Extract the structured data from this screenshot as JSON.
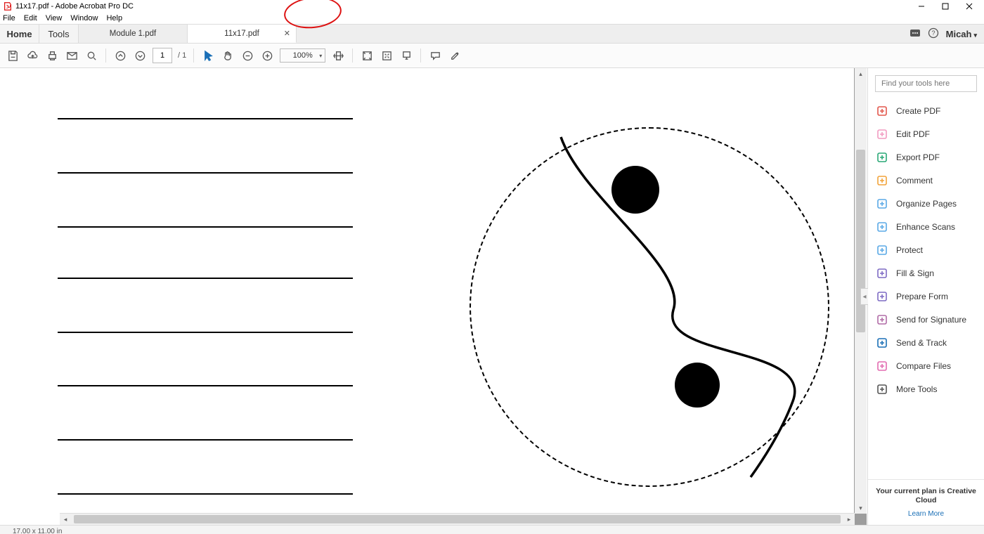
{
  "window": {
    "title": "11x17.pdf - Adobe Acrobat Pro DC"
  },
  "menu": {
    "file": "File",
    "edit": "Edit",
    "view": "View",
    "window": "Window",
    "help": "Help"
  },
  "tabs": {
    "home": "Home",
    "tools": "Tools",
    "docs": [
      {
        "label": "Module 1.pdf",
        "active": false
      },
      {
        "label": "11x17.pdf",
        "active": true
      }
    ],
    "user": "Micah"
  },
  "toolbar": {
    "page_current": "1",
    "page_total": "/ 1",
    "zoom": "100%"
  },
  "right_panel": {
    "search_placeholder": "Find your tools here",
    "items": [
      {
        "label": "Create PDF",
        "color": "#e2574c"
      },
      {
        "label": "Edit PDF",
        "color": "#f29bc1"
      },
      {
        "label": "Export PDF",
        "color": "#2aa876"
      },
      {
        "label": "Comment",
        "color": "#f2a33a"
      },
      {
        "label": "Organize Pages",
        "color": "#5aa9e6"
      },
      {
        "label": "Enhance Scans",
        "color": "#5aa9e6"
      },
      {
        "label": "Protect",
        "color": "#5aa9e6"
      },
      {
        "label": "Fill & Sign",
        "color": "#7e6bc4"
      },
      {
        "label": "Prepare Form",
        "color": "#7e6bc4"
      },
      {
        "label": "Send for Signature",
        "color": "#b16ba6"
      },
      {
        "label": "Send & Track",
        "color": "#1a6fb6"
      },
      {
        "label": "Compare Files",
        "color": "#e26bb0"
      },
      {
        "label": "More Tools",
        "color": "#555555"
      }
    ],
    "plan": "Your current plan is Creative Cloud",
    "learn": "Learn More"
  },
  "status": {
    "dimensions": "17.00 x 11.00 in"
  },
  "icons": {
    "arrow_select": "arrow-select-icon",
    "pan": "pan-hand-icon"
  }
}
